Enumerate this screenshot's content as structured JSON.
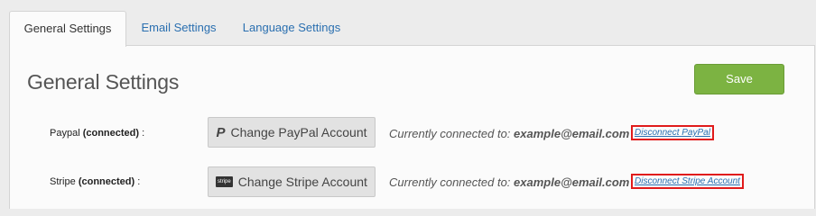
{
  "tabs": [
    {
      "label": "General Settings",
      "active": true
    },
    {
      "label": "Email Settings",
      "active": false
    },
    {
      "label": "Language Settings",
      "active": false
    }
  ],
  "panel": {
    "title": "General Settings",
    "save_label": "Save"
  },
  "rows": [
    {
      "label_name": "Paypal",
      "label_status": "(connected)",
      "label_suffix": ":",
      "icon": "paypal-icon",
      "button_label": "Change PayPal Account",
      "connected_prefix": "Currently connected to:",
      "connected_email": "example@email.com",
      "disconnect_label": "Disconnect PayPal"
    },
    {
      "label_name": "Stripe",
      "label_status": "(connected)",
      "label_suffix": ":",
      "icon": "stripe-icon",
      "icon_text": "stripe",
      "button_label": "Change Stripe Account",
      "connected_prefix": "Currently connected to:",
      "connected_email": "example@email.com",
      "disconnect_label": "Disconnect Stripe Account"
    }
  ],
  "colors": {
    "accent_link": "#2a6fb0",
    "save_green": "#7cb342",
    "highlight_red": "#e01b1b"
  }
}
